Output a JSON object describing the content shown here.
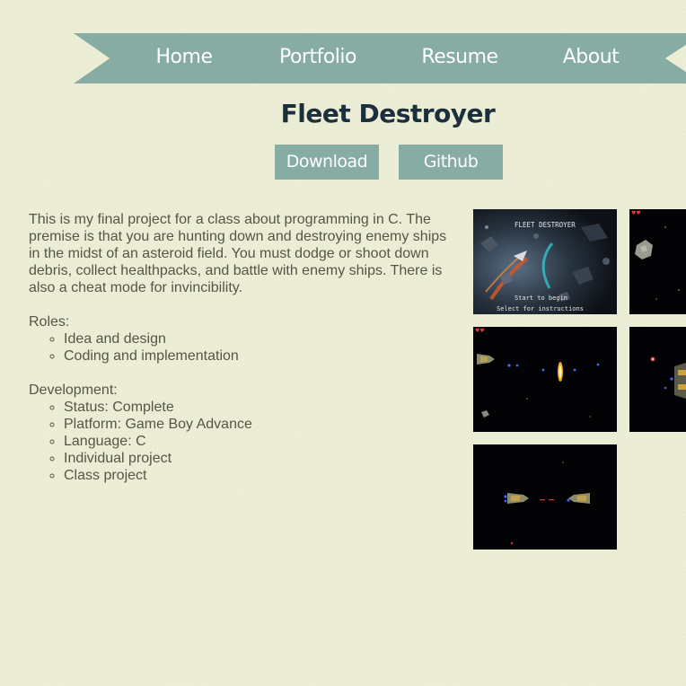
{
  "nav": {
    "items": [
      {
        "label": "Home"
      },
      {
        "label": "Portfolio"
      },
      {
        "label": "Resume"
      },
      {
        "label": "About"
      }
    ],
    "color": "#86aca3"
  },
  "project": {
    "title": "Fleet Destroyer",
    "download_label": "Download",
    "github_label": "Github",
    "description": "This is my final project for a class about programming in C. The premise is that you are hunting down and destroying enemy ships in the midst of an asteroid field. You must dodge or shoot down debris, collect healthpacks, and battle with enemy ships. There is also a cheat mode for invincibility.",
    "roles_heading": "Roles:",
    "roles": [
      "Idea and design",
      "Coding and implementation"
    ],
    "development_heading": "Development:",
    "development": [
      "Status: Complete",
      "Platform: Game Boy Advance",
      "Language: C",
      "Individual project",
      "Class project"
    ]
  },
  "screenshots": {
    "title_screen": {
      "title": "FLEET DESTROYER",
      "line1": "Start to begin",
      "line2": "Select for instructions"
    }
  },
  "colors": {
    "background": "#eceed5",
    "accent": "#86aca3",
    "title": "#1b2f3c",
    "body_text": "#555548"
  }
}
